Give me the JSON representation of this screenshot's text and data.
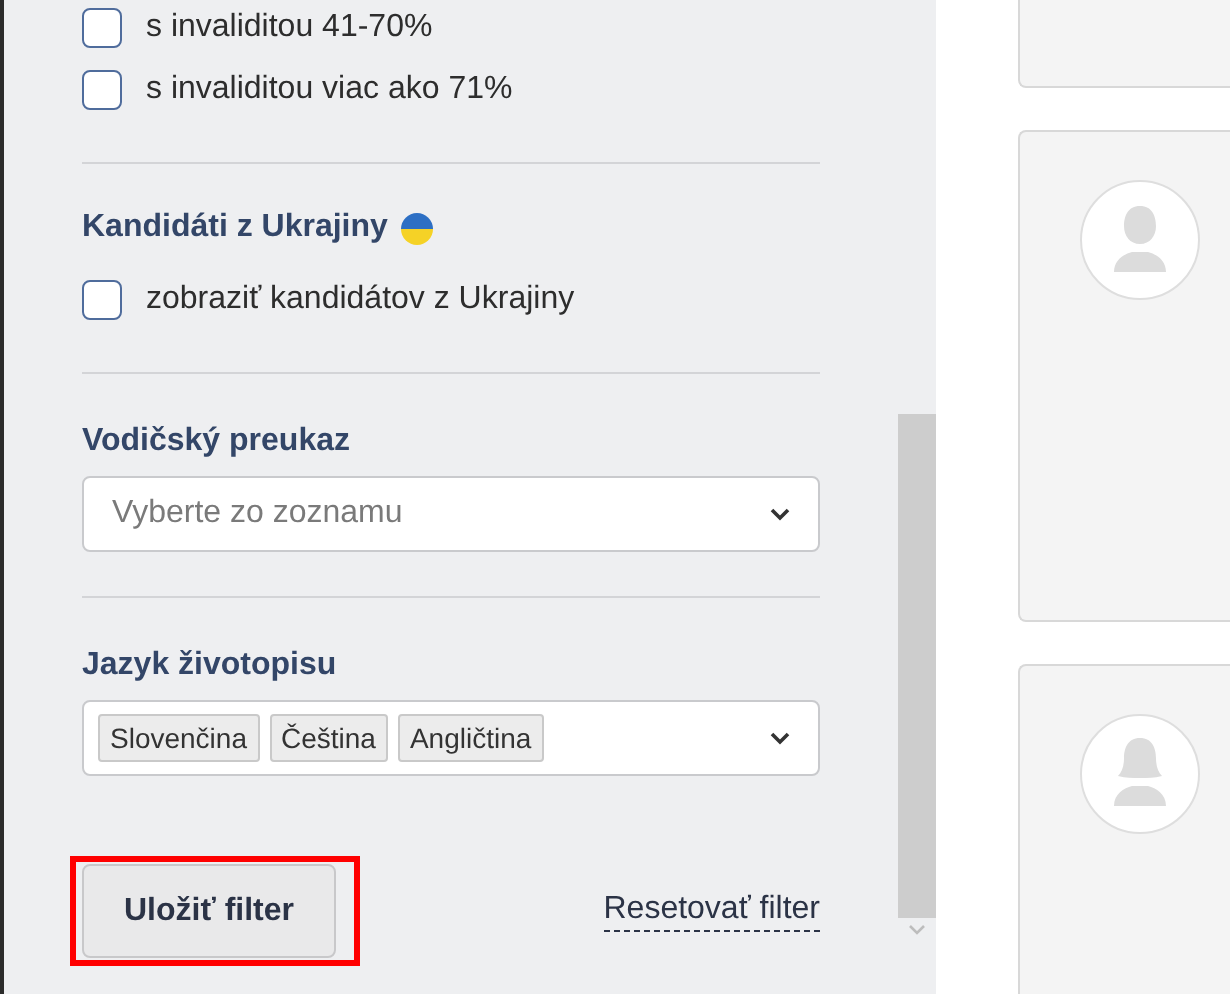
{
  "filters": {
    "disability_options": [
      {
        "label": "s invaliditou 41-70%",
        "checked": false
      },
      {
        "label": "s invaliditou viac ako 71%",
        "checked": false
      }
    ],
    "ukraine": {
      "heading": "Kandidáti z Ukrajiny",
      "options": [
        {
          "label": "zobraziť kandidátov z Ukrajiny",
          "checked": false
        }
      ]
    },
    "driving_license": {
      "heading": "Vodičský preukaz",
      "placeholder": "Vyberte zo zoznamu"
    },
    "cv_language": {
      "heading": "Jazyk životopisu",
      "tags": [
        "Slovenčina",
        "Čeština",
        "Angličtina"
      ]
    },
    "save_button": {
      "label": "Uložiť filter",
      "highlighted": true
    },
    "reset_link": "Resetovať filter"
  },
  "cards": [
    {
      "kind": "blank"
    },
    {
      "kind": "man"
    },
    {
      "kind": "woman"
    }
  ]
}
